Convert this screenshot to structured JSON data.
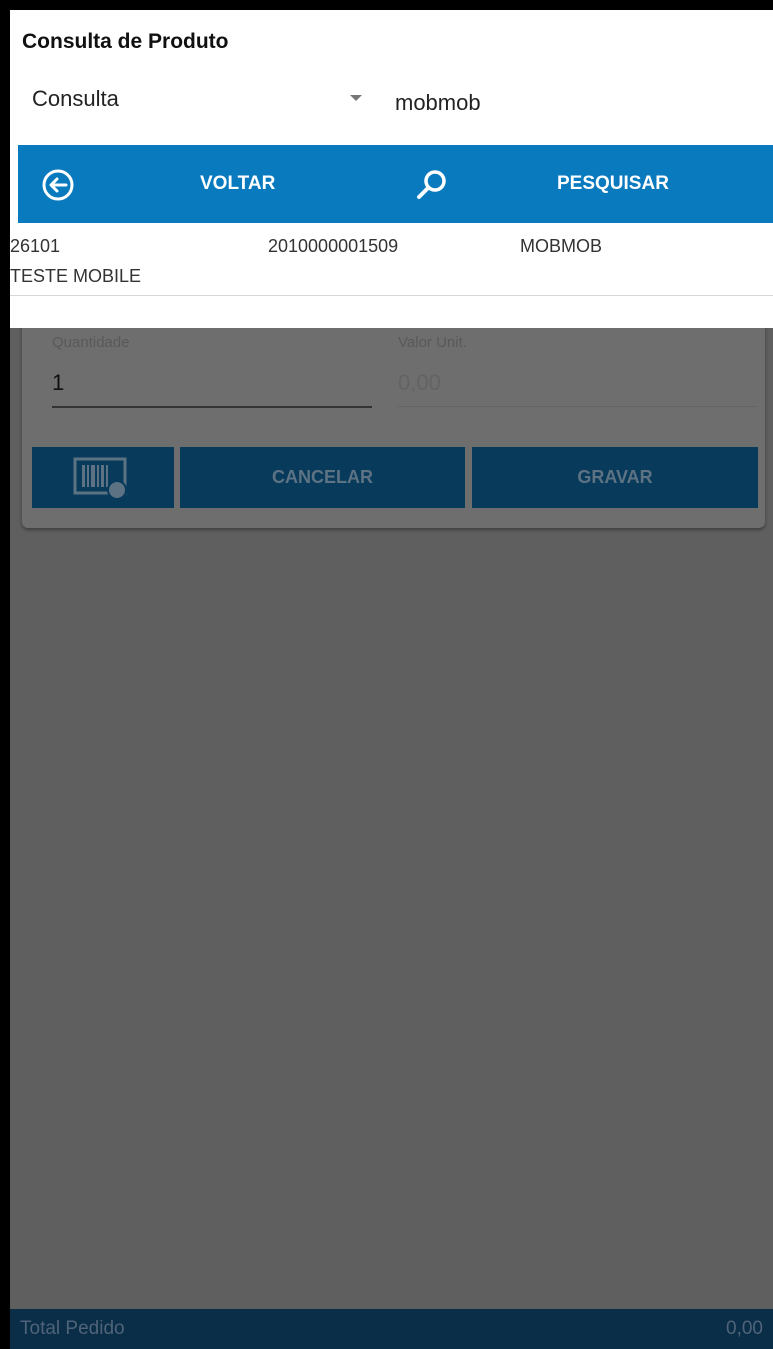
{
  "dialog": {
    "title": "Consulta de Produto",
    "search_type": "Consulta",
    "search_value": "mobmob",
    "back_label": "VOLTAR",
    "search_label": "PESQUISAR",
    "results": [
      {
        "code": "26101",
        "barcode": "2010000001509",
        "reference": "MOBMOB",
        "description": "TESTE MOBILE"
      }
    ]
  },
  "form": {
    "quantity_label": "Quantidade",
    "quantity_value": "1",
    "unit_price_label": "Valor Unit.",
    "unit_price_value": "0,00",
    "cancel_label": "CANCELAR",
    "save_label": "GRAVAR"
  },
  "footer": {
    "total_label": "Total Pedido",
    "total_value": "0,00"
  },
  "colors": {
    "action_bar": "#0a7abf",
    "form_button": "#083a5c",
    "footer_bar": "#0a2d48",
    "overlay": "#5f5f5f"
  }
}
